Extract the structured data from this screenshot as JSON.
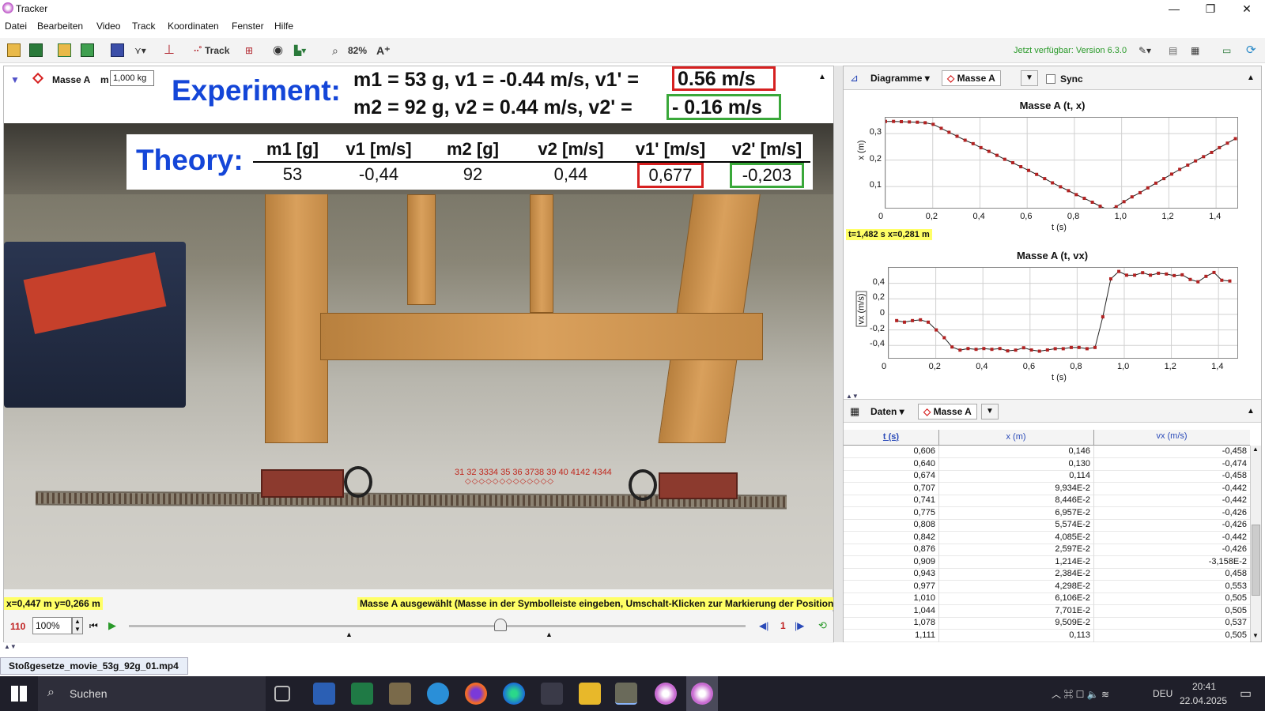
{
  "window": {
    "title": "Tracker",
    "minimize": "—",
    "maximize": "❐",
    "close": "✕"
  },
  "menu": [
    "Datei",
    "Bearbeiten",
    "Video",
    "Track",
    "Koordinaten",
    "Fenster",
    "Hilfe"
  ],
  "toolbar": {
    "track_label": "Track",
    "zoom": "82%",
    "update_notice": "Jetzt verfügbar: Version 6.3.0"
  },
  "video_header": {
    "track_name": "Masse A",
    "mass_label": "m",
    "mass_value": "1,000 kg"
  },
  "experiment": {
    "title": "Experiment:",
    "line1_text": "m1 = 53 g, v1 = -0.44 m/s, v1' =",
    "line1_box": "0.56 m/s",
    "line2_text": "m2 = 92 g, v2 = 0.44 m/s, v2' =",
    "line2_box": "- 0.16 m/s"
  },
  "theory": {
    "title": "Theory:",
    "headers": [
      "m1 [g]",
      "v1 [m/s]",
      "m2 [g]",
      "v2 [m/s]",
      "v1' [m/s]",
      "v2' [m/s]"
    ],
    "values": [
      "53",
      "-0,44",
      "92",
      "0,44",
      "0,677",
      "-0,203"
    ]
  },
  "frame_markers": "31 32 3334 35 36 3738 39 40 4142 4344",
  "status": {
    "coords": "x=0,447 m  y=0,266 m",
    "message": "Masse A ausgewählt (Masse in der Symbolleiste eingeben, Umschalt-Klicken zur Markierung der Position)"
  },
  "player": {
    "frame": "110",
    "zoom": "100%",
    "step": "1"
  },
  "right_panel": {
    "plot_dropdown": "Diagramme",
    "plot_track": "Masse A",
    "sync_label": "Sync",
    "plot1_title": "Masse A (t, x)",
    "plot1_ylabel": "x (m)",
    "plot1_xlabel": "t (s)",
    "plot1_readout": "t=1,482 s  x=0,281 m",
    "plot2_title": "Masse A (t, vx)",
    "plot2_ylabel": "vx (m/s)",
    "plot2_xlabel": "t (s)",
    "table_dropdown": "Daten",
    "table_track": "Masse A"
  },
  "plot1": {
    "x_ticks": [
      "0",
      "0,2",
      "0,4",
      "0,6",
      "0,8",
      "1,0",
      "1,2",
      "1,4"
    ],
    "y_ticks": [
      "0,3",
      "0,2",
      "0,1"
    ],
    "t": [
      0,
      0.034,
      0.067,
      0.101,
      0.135,
      0.168,
      0.202,
      0.236,
      0.269,
      0.303,
      0.337,
      0.371,
      0.404,
      0.438,
      0.472,
      0.505,
      0.539,
      0.573,
      0.606,
      0.64,
      0.674,
      0.707,
      0.741,
      0.775,
      0.808,
      0.842,
      0.876,
      0.909,
      0.943,
      0.977,
      1.01,
      1.044,
      1.078,
      1.111,
      1.145,
      1.179,
      1.212,
      1.246,
      1.28,
      1.313,
      1.347,
      1.381,
      1.414,
      1.448,
      1.482
    ],
    "x": [
      0.346,
      0.346,
      0.345,
      0.344,
      0.343,
      0.341,
      0.335,
      0.32,
      0.305,
      0.29,
      0.275,
      0.262,
      0.247,
      0.233,
      0.218,
      0.203,
      0.19,
      0.175,
      0.161,
      0.146,
      0.13,
      0.114,
      0.0993,
      0.0845,
      0.0696,
      0.0557,
      0.0409,
      0.026,
      0.0121,
      0.0238,
      0.043,
      0.0611,
      0.077,
      0.0951,
      0.113,
      0.13,
      0.147,
      0.165,
      0.181,
      0.197,
      0.213,
      0.229,
      0.247,
      0.264,
      0.281
    ]
  },
  "plot2": {
    "x_ticks": [
      "0",
      "0,2",
      "0,4",
      "0,6",
      "0,8",
      "1,0",
      "1,2",
      "1,4"
    ],
    "y_ticks": [
      "0,4",
      "0,2",
      "0",
      "-0,2",
      "-0,4"
    ],
    "t": [
      0.034,
      0.067,
      0.101,
      0.135,
      0.168,
      0.202,
      0.236,
      0.269,
      0.303,
      0.337,
      0.371,
      0.404,
      0.438,
      0.472,
      0.505,
      0.539,
      0.573,
      0.606,
      0.64,
      0.674,
      0.707,
      0.741,
      0.775,
      0.808,
      0.842,
      0.876,
      0.909,
      0.943,
      0.977,
      1.01,
      1.044,
      1.078,
      1.111,
      1.145,
      1.179,
      1.212,
      1.246,
      1.28,
      1.313,
      1.347,
      1.381,
      1.414,
      1.448
    ],
    "vx": [
      -0.08,
      -0.1,
      -0.08,
      -0.07,
      -0.1,
      -0.2,
      -0.3,
      -0.42,
      -0.46,
      -0.44,
      -0.45,
      -0.44,
      -0.45,
      -0.44,
      -0.47,
      -0.46,
      -0.43,
      -0.458,
      -0.474,
      -0.458,
      -0.442,
      -0.442,
      -0.426,
      -0.426,
      -0.442,
      -0.426,
      -0.0316,
      0.458,
      0.553,
      0.505,
      0.505,
      0.537,
      0.505,
      0.53,
      0.52,
      0.5,
      0.51,
      0.45,
      0.42,
      0.49,
      0.54,
      0.44,
      0.43
    ]
  },
  "data_table": {
    "headers": [
      "t (s)",
      "x (m)",
      "vx (m/s)"
    ],
    "rows": [
      [
        "0,606",
        "0,146",
        "-0,458"
      ],
      [
        "0,640",
        "0,130",
        "-0,474"
      ],
      [
        "0,674",
        "0,114",
        "-0,458"
      ],
      [
        "0,707",
        "9,934E-2",
        "-0,442"
      ],
      [
        "0,741",
        "8,446E-2",
        "-0,442"
      ],
      [
        "0,775",
        "6,957E-2",
        "-0,426"
      ],
      [
        "0,808",
        "5,574E-2",
        "-0,426"
      ],
      [
        "0,842",
        "4,085E-2",
        "-0,442"
      ],
      [
        "0,876",
        "2,597E-2",
        "-0,426"
      ],
      [
        "0,909",
        "1,214E-2",
        "-3,158E-2"
      ],
      [
        "0,943",
        "2,384E-2",
        "0,458"
      ],
      [
        "0,977",
        "4,298E-2",
        "0,553"
      ],
      [
        "1,010",
        "6,106E-2",
        "0,505"
      ],
      [
        "1,044",
        "7,701E-2",
        "0,505"
      ],
      [
        "1,078",
        "9,509E-2",
        "0,537"
      ],
      [
        "1,111",
        "0,113",
        "0,505"
      ]
    ]
  },
  "file_tab": "Stoßgesetze_movie_53g_92g_01.mp4",
  "taskbar": {
    "search": "Suchen",
    "lang": "DEU",
    "time": "20:41",
    "date": "22.04.2025"
  },
  "colors": {
    "red_box": "#d62020",
    "green_box": "#3aa83a",
    "blue_title": "#1446d8",
    "highlight": "#ffff66",
    "marker": "#b22222"
  }
}
